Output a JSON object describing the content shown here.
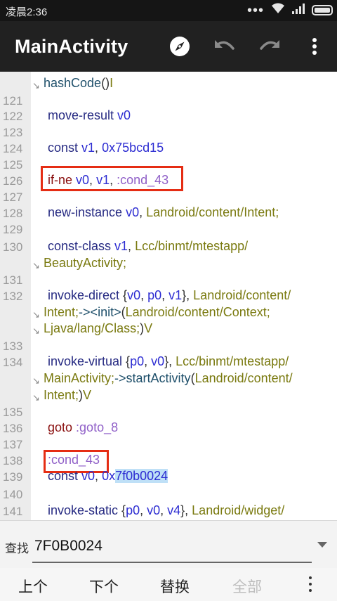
{
  "status_bar": {
    "time": "凌晨2:36",
    "dots": "•••"
  },
  "app_bar": {
    "title": "MainActivity"
  },
  "code_lines": [
    {
      "segments": [
        {
          "text": "hashCode",
          "c": "m"
        },
        {
          "text": "()",
          "c": "p"
        },
        {
          "text": "I",
          "c": "t"
        }
      ]
    },
    {
      "number": "121"
    },
    {
      "number": "122",
      "segments": [
        {
          "text": "move-result ",
          "c": "k"
        },
        {
          "text": "v0",
          "c": "r"
        }
      ]
    },
    {
      "number": "123"
    },
    {
      "number": "124",
      "segments": [
        {
          "text": "const ",
          "c": "k"
        },
        {
          "text": "v1",
          "c": "r"
        },
        {
          "text": ", ",
          "c": "p"
        },
        {
          "text": "0x75bcd15",
          "c": "r"
        }
      ]
    },
    {
      "number": "125"
    },
    {
      "number": "126",
      "segments": [
        {
          "text": "if-ne ",
          "c": "c"
        },
        {
          "text": "v0",
          "c": "r"
        },
        {
          "text": ", ",
          "c": "p"
        },
        {
          "text": "v1",
          "c": "r"
        },
        {
          "text": ", ",
          "c": "p"
        },
        {
          "text": ":cond_43",
          "c": "l"
        }
      ]
    },
    {
      "number": "127"
    },
    {
      "number": "128",
      "segments": [
        {
          "text": "new-instance ",
          "c": "k"
        },
        {
          "text": "v0",
          "c": "r"
        },
        {
          "text": ", ",
          "c": "p"
        },
        {
          "text": "Landroid/content/Intent;",
          "c": "t"
        }
      ]
    },
    {
      "number": "129"
    },
    {
      "number": "130",
      "segments": [
        {
          "text": "const-class ",
          "c": "k"
        },
        {
          "text": "v1",
          "c": "r"
        },
        {
          "text": ", ",
          "c": "p"
        },
        {
          "text": "Lcc/binmt/mtestapp/",
          "c": "t"
        }
      ]
    },
    {
      "segments": [
        {
          "text": "BeautyActivity;",
          "c": "t"
        }
      ]
    },
    {
      "number": "131"
    },
    {
      "number": "132",
      "segments": [
        {
          "text": "invoke-direct ",
          "c": "k"
        },
        {
          "text": "{",
          "c": "p"
        },
        {
          "text": "v0",
          "c": "r"
        },
        {
          "text": ", ",
          "c": "p"
        },
        {
          "text": "p0",
          "c": "r"
        },
        {
          "text": ", ",
          "c": "p"
        },
        {
          "text": "v1",
          "c": "r"
        },
        {
          "text": "}, ",
          "c": "p"
        },
        {
          "text": "Landroid/content/",
          "c": "t"
        }
      ]
    },
    {
      "segments": [
        {
          "text": "Intent;",
          "c": "t"
        },
        {
          "text": "-><init>",
          "c": "m"
        },
        {
          "text": "(",
          "c": "p"
        },
        {
          "text": "Landroid/content/Context;",
          "c": "t"
        }
      ]
    },
    {
      "segments": [
        {
          "text": "Ljava/lang/Class;",
          "c": "t"
        },
        {
          "text": ")",
          "c": "p"
        },
        {
          "text": "V",
          "c": "t"
        }
      ]
    },
    {
      "number": "133"
    },
    {
      "number": "134",
      "segments": [
        {
          "text": "invoke-virtual ",
          "c": "k"
        },
        {
          "text": "{",
          "c": "p"
        },
        {
          "text": "p0",
          "c": "r"
        },
        {
          "text": ", ",
          "c": "p"
        },
        {
          "text": "v0",
          "c": "r"
        },
        {
          "text": "}, ",
          "c": "p"
        },
        {
          "text": "Lcc/binmt/mtestapp/",
          "c": "t"
        }
      ]
    },
    {
      "segments": [
        {
          "text": "MainActivity;",
          "c": "t"
        },
        {
          "text": "->startActivity",
          "c": "m"
        },
        {
          "text": "(",
          "c": "p"
        },
        {
          "text": "Landroid/content/",
          "c": "t"
        }
      ]
    },
    {
      "segments": [
        {
          "text": "Intent;",
          "c": "t"
        },
        {
          "text": ")",
          "c": "p"
        },
        {
          "text": "V",
          "c": "t"
        }
      ]
    },
    {
      "number": "135"
    },
    {
      "number": "136",
      "segments": [
        {
          "text": "goto ",
          "c": "c"
        },
        {
          "text": ":goto_8",
          "c": "l"
        }
      ]
    },
    {
      "number": "137"
    },
    {
      "number": "138",
      "segments": [
        {
          "text": ":cond_43",
          "c": "l"
        }
      ]
    },
    {
      "number": "139",
      "segments": [
        {
          "text": "const ",
          "c": "k"
        },
        {
          "text": "v0",
          "c": "r"
        },
        {
          "text": ", ",
          "c": "p"
        },
        {
          "text": "0x",
          "c": "r"
        },
        {
          "text": "7f0b0024",
          "c": "r",
          "hl": true
        }
      ]
    },
    {
      "number": "140"
    },
    {
      "number": "141",
      "segments": [
        {
          "text": "invoke-static ",
          "c": "k"
        },
        {
          "text": "{",
          "c": "p"
        },
        {
          "text": "p0",
          "c": "r"
        },
        {
          "text": ", ",
          "c": "p"
        },
        {
          "text": "v0",
          "c": "r"
        },
        {
          "text": ", ",
          "c": "p"
        },
        {
          "text": "v4",
          "c": "r"
        },
        {
          "text": "}, ",
          "c": "p"
        },
        {
          "text": "Landroid/widget/",
          "c": "t"
        }
      ]
    }
  ],
  "search": {
    "label": "查找",
    "value": "7F0B0024"
  },
  "bottom_actions": {
    "prev": "上个",
    "next": "下个",
    "replace": "替换",
    "all": "全部"
  },
  "colors": {
    "highlight_box": "#e52d14",
    "match_highlight": "#bfe0f7",
    "app_bar": "#212121"
  }
}
